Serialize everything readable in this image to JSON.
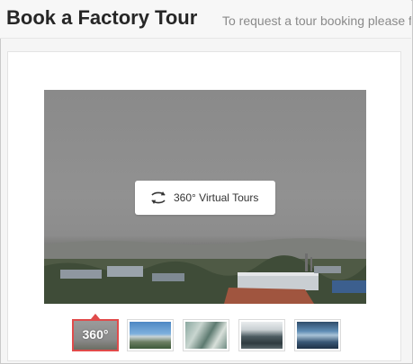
{
  "header": {
    "title": "Book a Factory Tour",
    "subtitle": "To request a tour booking please f"
  },
  "tour": {
    "badge_label": "360° Virtual Tours",
    "badge_icon": "rotate-360-icon"
  },
  "thumbnails": [
    {
      "label": "360°",
      "active": true
    },
    {
      "label": "",
      "active": false
    },
    {
      "label": "",
      "active": false
    },
    {
      "label": "",
      "active": false
    },
    {
      "label": "",
      "active": false
    }
  ],
  "colors": {
    "accent": "#e04b4b",
    "title": "#262626",
    "subtitle": "#8a8a8a"
  }
}
